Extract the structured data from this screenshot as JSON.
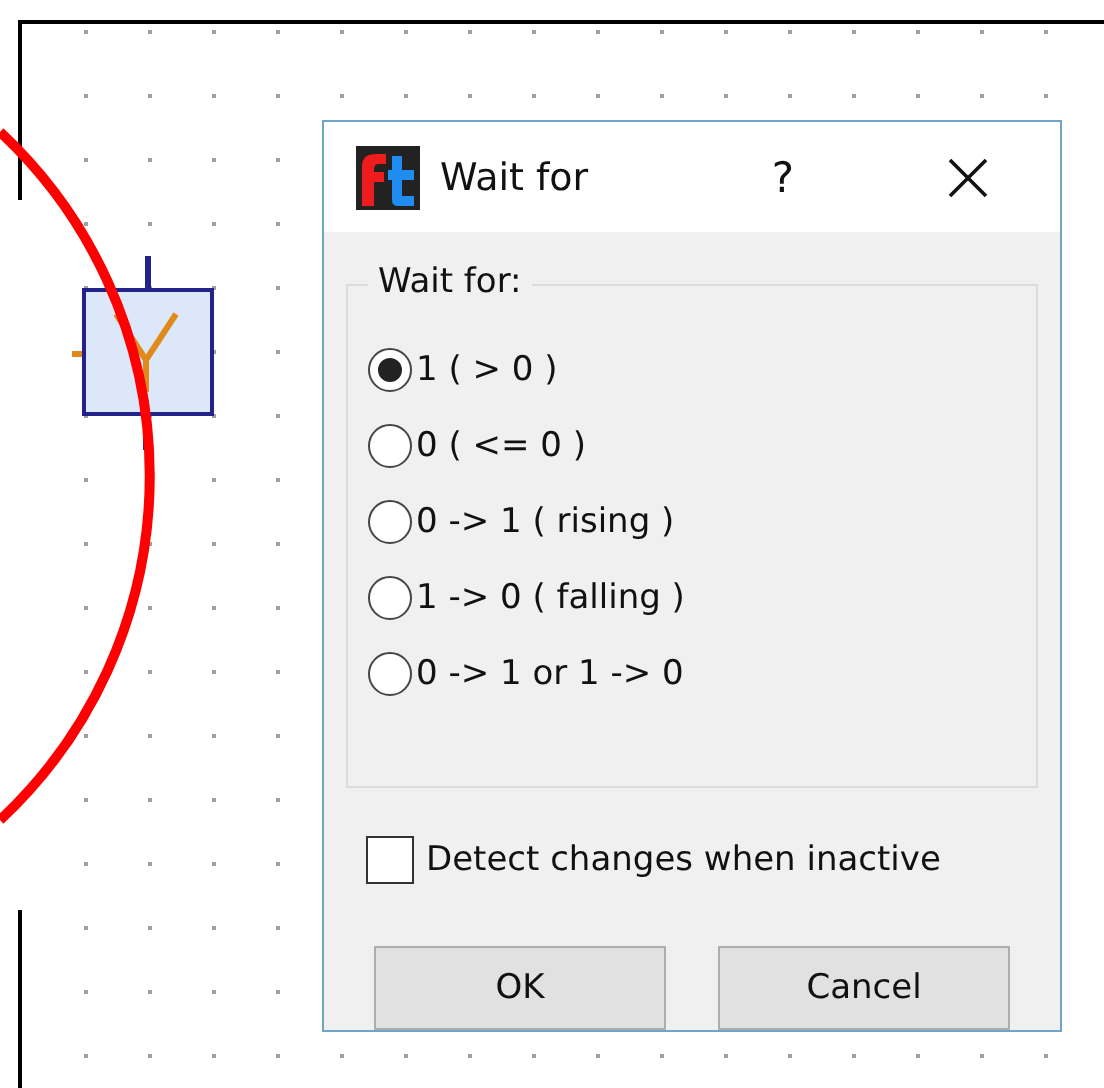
{
  "dialog": {
    "title": "Wait for",
    "help": "?",
    "group_label": "Wait for:",
    "options": [
      {
        "label": "1 ( > 0 )",
        "selected": true
      },
      {
        "label": "0 ( <= 0 )",
        "selected": false
      },
      {
        "label": "0 -> 1 ( rising )",
        "selected": false
      },
      {
        "label": "1 -> 0 ( falling )",
        "selected": false
      },
      {
        "label": "0 -> 1 or 1 -> 0",
        "selected": false
      }
    ],
    "checkbox": {
      "label": "Detect changes when inactive",
      "checked": false
    },
    "buttons": [
      "OK",
      "Cancel"
    ]
  }
}
